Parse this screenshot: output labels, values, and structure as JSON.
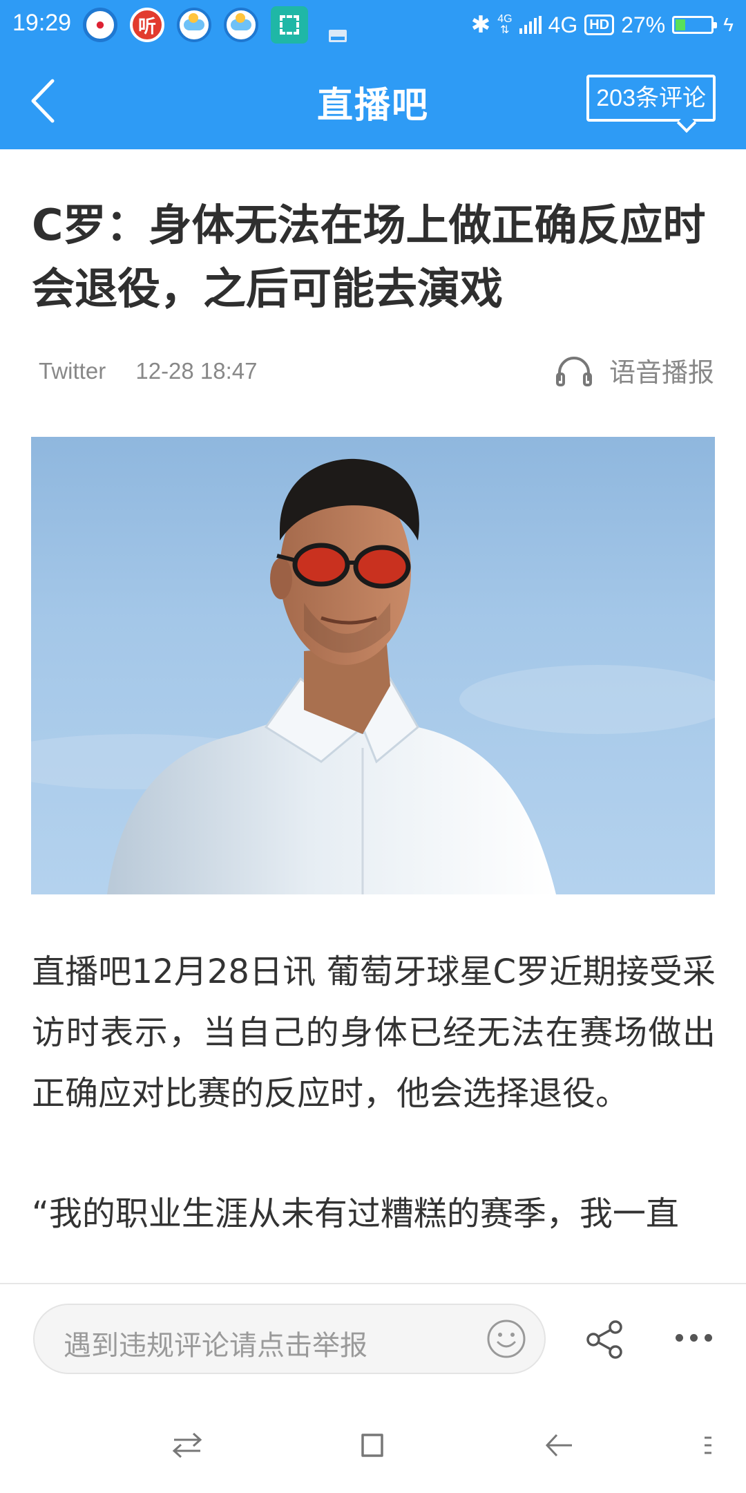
{
  "status_bar": {
    "time": "19:29",
    "app_icons": [
      "doraemon-app-icon",
      "ting-app-icon",
      "weather-app-icon",
      "weather-app-icon",
      "scan-app-icon",
      "clean-app-icon"
    ],
    "ting_glyph": "听",
    "network_small": "4G",
    "network": "4G",
    "hd_label": "HD",
    "battery": "27%",
    "battery_level": 0.27
  },
  "header": {
    "title": "直播吧",
    "comments_label": "203条评论",
    "accent_color": "#2e9bf5"
  },
  "article": {
    "title": "C罗：身体无法在场上做正确反应时会退役，之后可能去演戏",
    "source": "Twitter",
    "time": "12-28 18:47",
    "voice_label": "语音播报",
    "paragraphs": [
      "直播吧12月28日讯 葡萄牙球星C罗近期接受采访时表示，当自己的身体已经无法在赛场做出正确应对比赛的反应时，他会选择退役。",
      "“我的职业生涯从未有过糟糕的赛季，我一直"
    ]
  },
  "bottom_bar": {
    "comment_placeholder": "遇到违规评论请点击举报"
  }
}
